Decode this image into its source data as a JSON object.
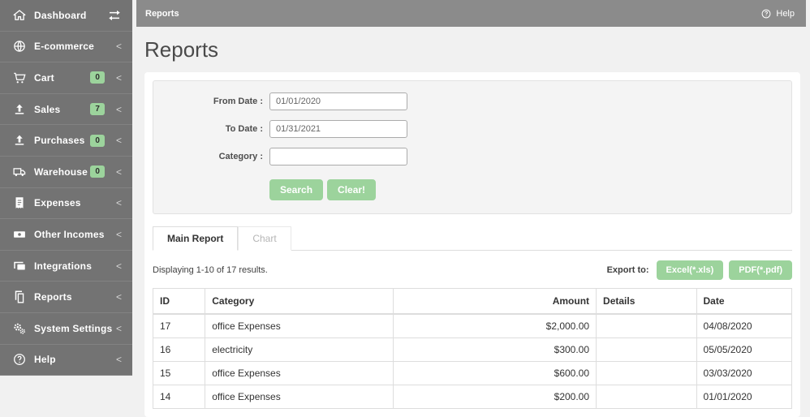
{
  "topbar": {
    "breadcrumb": "Reports",
    "help_label": "Help"
  },
  "sidebar": {
    "items": [
      {
        "label": "Dashboard",
        "icon": "home-icon",
        "right_icon": "swap-arrows-icon"
      },
      {
        "label": "E-commerce",
        "icon": "globe-icon",
        "chevron": true
      },
      {
        "label": "Cart",
        "icon": "cart-icon",
        "badge": "0",
        "chevron": true
      },
      {
        "label": "Sales",
        "icon": "upload-icon",
        "badge": "7",
        "chevron": true
      },
      {
        "label": "Purchases",
        "icon": "upload-icon",
        "badge": "0",
        "chevron": true
      },
      {
        "label": "Warehouse",
        "icon": "truck-icon",
        "badge": "0",
        "chevron": true
      },
      {
        "label": "Expenses",
        "icon": "receipt-icon",
        "chevron": true
      },
      {
        "label": "Other Incomes",
        "icon": "banknote-icon",
        "chevron": true
      },
      {
        "label": "Integrations",
        "icon": "devices-icon",
        "chevron": true
      },
      {
        "label": "Reports",
        "icon": "copy-icon",
        "chevron": true
      },
      {
        "label": "System Settings",
        "icon": "gears-icon",
        "chevron": true
      },
      {
        "label": "Help",
        "icon": "help-icon",
        "chevron": true
      }
    ]
  },
  "page": {
    "title": "Reports"
  },
  "filter": {
    "fields": [
      {
        "label": "From Date :",
        "value": "01/01/2020"
      },
      {
        "label": "To Date :",
        "value": "01/31/2021"
      },
      {
        "label": "Category :",
        "value": ""
      }
    ],
    "search_label": "Search",
    "clear_label": "Clear!"
  },
  "tabs": [
    {
      "label": "Main Report",
      "active": true
    },
    {
      "label": "Chart",
      "active": false
    }
  ],
  "results": {
    "summary": "Displaying 1-10 of 17 results."
  },
  "export": {
    "label": "Export to:",
    "buttons": [
      "Excel(*.xls)",
      "PDF(*.pdf)"
    ]
  },
  "table": {
    "columns": [
      {
        "label": "ID"
      },
      {
        "label": "Category"
      },
      {
        "label": "Amount",
        "align": "right"
      },
      {
        "label": "Details"
      },
      {
        "label": "Date"
      }
    ],
    "rows": [
      [
        "17",
        "office Expenses",
        "$2,000.00",
        "",
        "04/08/2020"
      ],
      [
        "16",
        "electricity",
        "$300.00",
        "",
        "05/05/2020"
      ],
      [
        "15",
        "office Expenses",
        "$600.00",
        "",
        "03/03/2020"
      ],
      [
        "14",
        "office Expenses",
        "$200.00",
        "",
        "01/01/2020"
      ]
    ]
  },
  "colors": {
    "accent_green": "#9cd39c",
    "sidebar_bg": "#737373",
    "topbar_bg": "#8b8b8b"
  }
}
